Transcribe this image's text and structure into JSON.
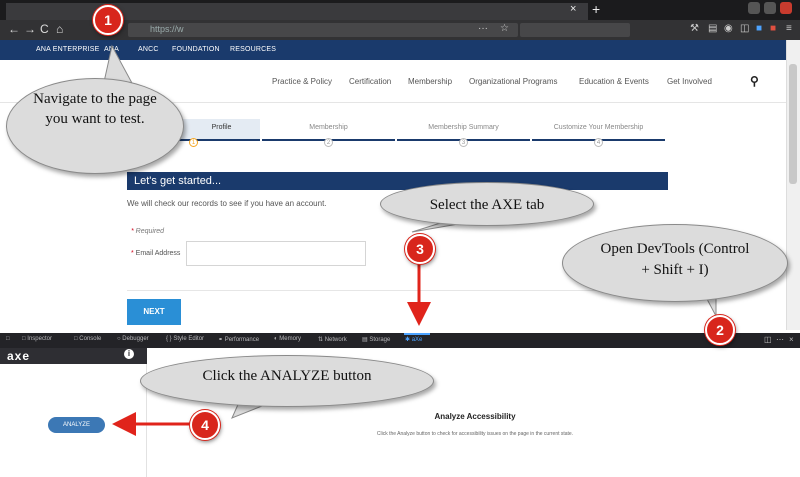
{
  "browser": {
    "url": "https://w",
    "url_dots": "···",
    "tab_close": "×",
    "new_tab": "+",
    "nav_icons": {
      "back": "←",
      "forward": "→",
      "reload": "C",
      "home": "⌂"
    },
    "toolbar_icons": {
      "bookmark": "☆",
      "menu": "≡"
    }
  },
  "site": {
    "strip_links": [
      "ANA ENTERPRISE",
      "ANA",
      "ANCC",
      "FOUNDATION",
      "RESOURCES"
    ],
    "main_nav": [
      "Practice & Policy",
      "Certification",
      "Membership",
      "Organizational Programs",
      "Education & Events",
      "Get Involved"
    ],
    "search_icon": "search-icon",
    "steps": [
      {
        "label": "Profile",
        "num": "1"
      },
      {
        "label": "Membership",
        "num": "2"
      },
      {
        "label": "Membership Summary",
        "num": "3"
      },
      {
        "label": "Customize Your Membership",
        "num": "4"
      }
    ],
    "banner": "Let's get started...",
    "intro": "We will check our records to see if you have an account.",
    "required": "Required",
    "email_label": "Email Address",
    "next_button": "NEXT"
  },
  "devtools": {
    "tabs": [
      "Inspector",
      "Console",
      "Debugger",
      "Style Editor",
      "Performance",
      "Memory",
      "Network",
      "Storage",
      "aXe"
    ],
    "active_tab": "aXe"
  },
  "axe": {
    "logo": "axe",
    "info": "i",
    "analyze_button": "ANALYZE",
    "panel_title": "Analyze Accessibility",
    "panel_desc": "Click the Analyze button to check for accessibility issues on the page in the current state."
  },
  "annotations": [
    {
      "num": "1",
      "text": "Navigate to the page you want to test."
    },
    {
      "num": "2",
      "text": "Open DevTools (Control + Shift + I)"
    },
    {
      "num": "3",
      "text": "Select the AXE tab"
    },
    {
      "num": "4",
      "text": "Click the ANALYZE button"
    }
  ],
  "colors": {
    "brand_navy": "#1a3a6c",
    "next_blue": "#2a8fd6",
    "analyze_blue": "#3c78b5",
    "badge_red": "#d8261c",
    "arrow_red": "#e0241b"
  }
}
